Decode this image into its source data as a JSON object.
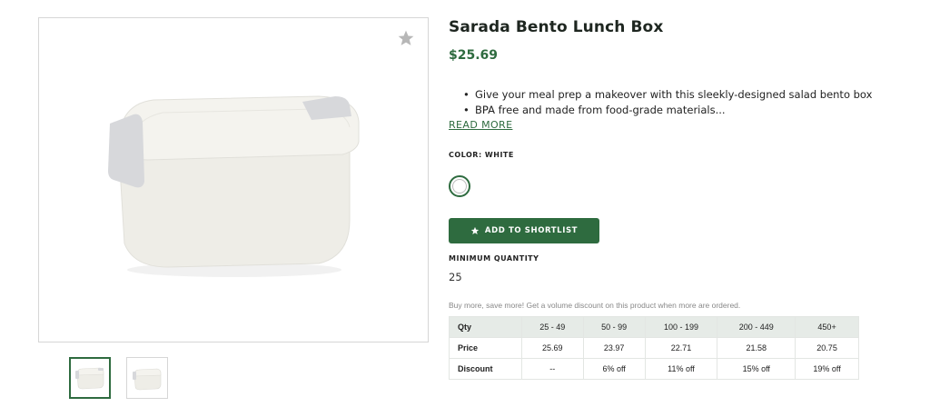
{
  "product": {
    "title": "Sarada Bento Lunch Box",
    "price": "$25.69",
    "bullets": [
      "Give your meal prep a makeover with this sleekly-designed salad bento box",
      "BPA free and made from food-grade materials..."
    ],
    "read_more_label": "READ MORE",
    "color_label": "COLOR: WHITE",
    "selected_color": "#ffffff",
    "shortlist_label": "ADD TO SHORTLIST",
    "min_quantity_label": "MINIMUM QUANTITY",
    "min_quantity_value": "25",
    "volume_note": "Buy more, save more! Get a volume discount on this product when more are ordered."
  },
  "icons": {
    "favorite": "star-icon",
    "shortlist": "star-icon"
  },
  "colors": {
    "brand_green": "#2e6b3f",
    "table_header_bg": "#e6ebe7",
    "favorite_icon": "#b7b7b7"
  },
  "price_table": {
    "headers": [
      "Qty",
      "25 - 49",
      "50 - 99",
      "100 - 199",
      "200 - 449",
      "450+"
    ],
    "rows": [
      [
        "Price",
        "25.69",
        "23.97",
        "22.71",
        "21.58",
        "20.75"
      ],
      [
        "Discount",
        "--",
        "6% off",
        "11% off",
        "15% off",
        "19% off"
      ]
    ]
  }
}
